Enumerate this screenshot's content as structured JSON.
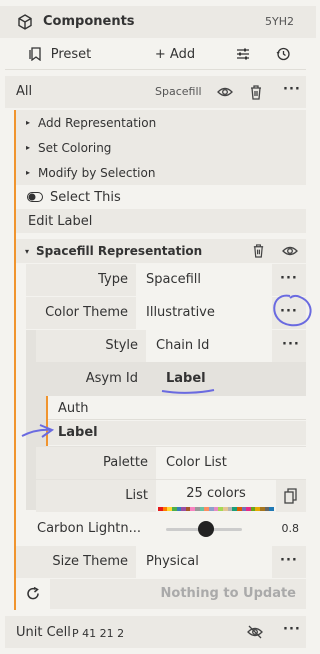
{
  "header": {
    "title": "Components",
    "structure_id": "5YH2"
  },
  "toolbar": {
    "preset_label": "Preset",
    "add_label": "+ Add"
  },
  "group": {
    "name": "All",
    "badge": "Spacefill",
    "actions": [
      "Add Representation",
      "Set Coloring",
      "Modify by Selection"
    ],
    "select_this": "Select This",
    "edit_label": "Edit Label"
  },
  "representation": {
    "title": "Spacefill Representation",
    "type_label": "Type",
    "type_value": "Spacefill",
    "color_theme_label": "Color Theme",
    "color_theme_value": "Illustrative",
    "style_label": "Style",
    "style_value": "Chain Id",
    "asym_label": "Asym Id",
    "asym_value": "Label",
    "asym_options": [
      "Auth",
      "Label"
    ],
    "palette_label": "Palette",
    "palette_value": "Color List",
    "list_label": "List",
    "list_value": "25 colors",
    "carbon_label": "Carbon Lightn...",
    "carbon_value": "0.8",
    "carbon_fraction": 0.53,
    "size_theme_label": "Size Theme",
    "size_theme_value": "Physical",
    "nothing_to_update": "Nothing to Update"
  },
  "unit_cell": {
    "label": "Unit Cell",
    "group": "P 41 21 2"
  },
  "palette_colors": [
    "#e41a1c",
    "#ff7f00",
    "#ffd92f",
    "#4daf4a",
    "#377eb8",
    "#984ea3",
    "#a65628",
    "#f781bf",
    "#999999",
    "#66c2a5",
    "#fc8d62",
    "#8da0cb",
    "#e78ac3",
    "#a6d854",
    "#e5c494",
    "#b3b3b3",
    "#1b9e77",
    "#d95f02",
    "#7570b3",
    "#e7298a",
    "#66a61e",
    "#e6ab02",
    "#a6761d",
    "#666666",
    "#1f78b4"
  ],
  "colors": {
    "accent": "#f0942e",
    "annotation": "#6a6ae0"
  }
}
